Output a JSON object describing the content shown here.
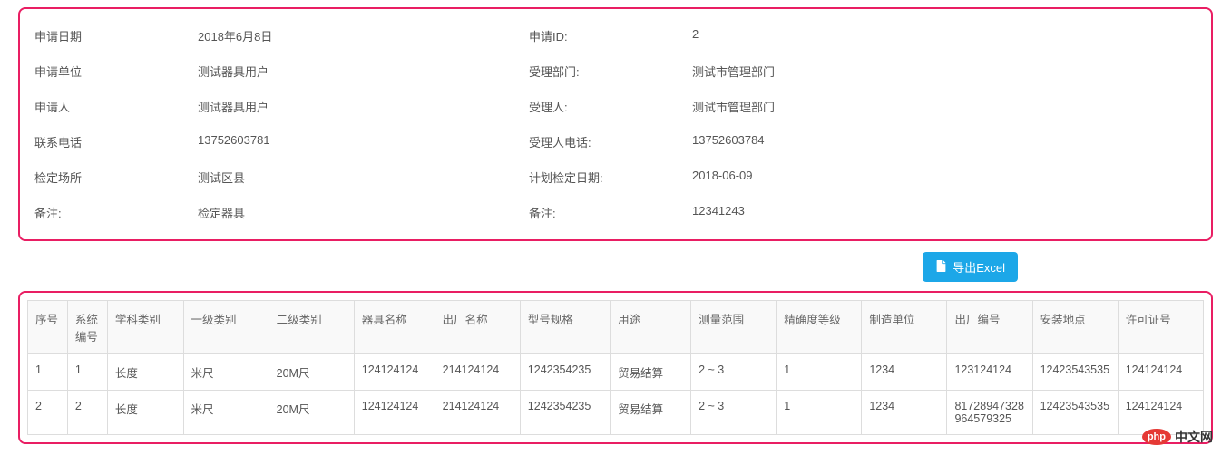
{
  "info": {
    "r1": {
      "l1": "申请日期",
      "v1": "2018年6月8日",
      "l2": "申请ID:",
      "v2": "2"
    },
    "r2": {
      "l1": "申请单位",
      "v1": "测试器具用户",
      "l2": "受理部门:",
      "v2": "测试市管理部门"
    },
    "r3": {
      "l1": "申请人",
      "v1": "测试器具用户",
      "l2": "受理人:",
      "v2": "测试市管理部门"
    },
    "r4": {
      "l1": "联系电话",
      "v1": "13752603781",
      "l2": "受理人电话:",
      "v2": "13752603784"
    },
    "r5": {
      "l1": "检定场所",
      "v1": "测试区县",
      "l2": "计划检定日期:",
      "v2": "2018-06-09"
    },
    "r6": {
      "l1": "备注:",
      "v1": "检定器具",
      "l2": "备注:",
      "v2": "12341243"
    }
  },
  "export_label": "导出Excel",
  "table": {
    "headers": {
      "seq": "序号",
      "sys": "系统编号",
      "sci": "学科类别",
      "l1": "一级类别",
      "l2": "二级类别",
      "name": "器具名称",
      "fname": "出厂名称",
      "model": "型号规格",
      "use": "用途",
      "range": "测量范围",
      "acc": "精确度等级",
      "manu": "制造单位",
      "fno": "出厂编号",
      "loc": "安装地点",
      "lic": "许可证号"
    },
    "rows": [
      {
        "seq": "1",
        "sys": "1",
        "sci": "长度",
        "l1": "米尺",
        "l2": "20M尺",
        "name": "124124124",
        "fname": "214124124",
        "model": "1242354235",
        "use": "贸易结算",
        "range": "2 ~ 3",
        "acc": "1",
        "manu": "1234",
        "fno": "123124124",
        "loc": "12423543535",
        "lic": "124124124"
      },
      {
        "seq": "2",
        "sys": "2",
        "sci": "长度",
        "l1": "米尺",
        "l2": "20M尺",
        "name": "124124124",
        "fname": "214124124",
        "model": "1242354235",
        "use": "贸易结算",
        "range": "2 ~ 3",
        "acc": "1",
        "manu": "1234",
        "fno": "81728947328964579325",
        "loc": "12423543535",
        "lic": "124124124"
      }
    ]
  },
  "watermark": {
    "badge": "php",
    "text": "中文网"
  }
}
